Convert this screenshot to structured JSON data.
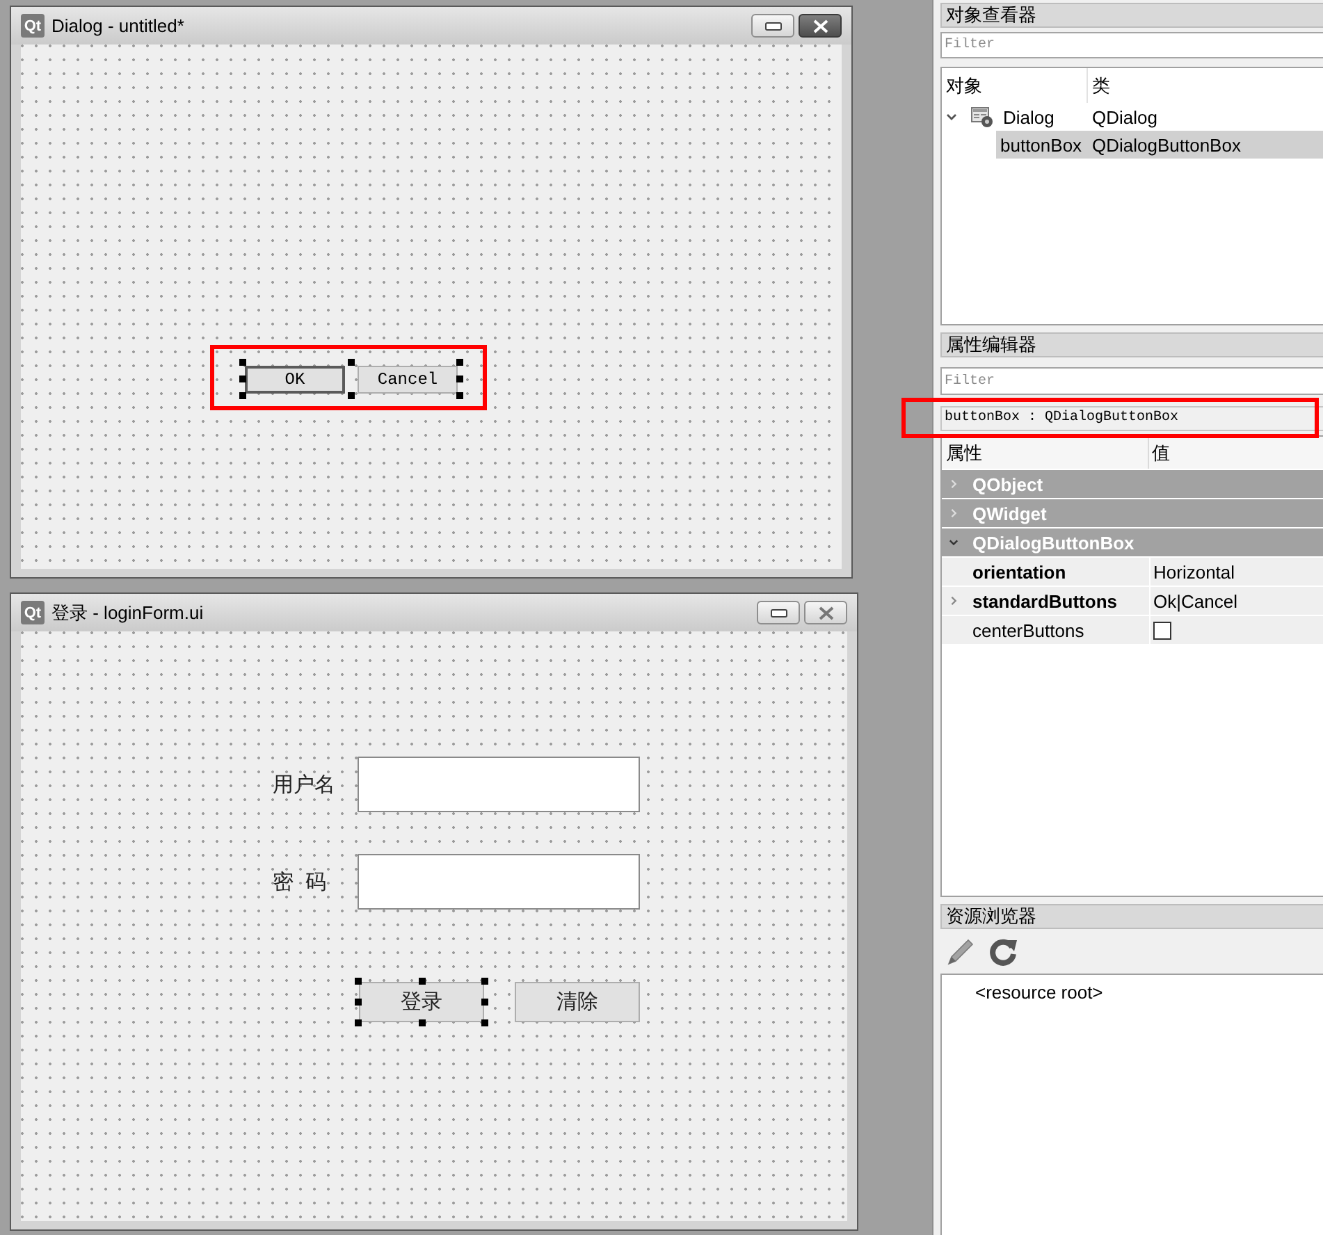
{
  "mdi_windows": [
    {
      "logo": "Qt",
      "title": "Dialog - untitled*",
      "active": true,
      "button_box": {
        "selected": true,
        "buttons": [
          {
            "label": "OK",
            "default": true
          },
          {
            "label": "Cancel",
            "default": false
          }
        ]
      }
    },
    {
      "logo": "Qt",
      "title": "登录 - loginForm.ui",
      "active": false,
      "fields": [
        {
          "label": "用户名"
        },
        {
          "label": "密  码"
        }
      ],
      "buttons": [
        {
          "label": "登录",
          "selected": true
        },
        {
          "label": "清除",
          "selected": false
        }
      ]
    }
  ],
  "object_inspector": {
    "title": "对象查看器",
    "filter": {
      "placeholder": "Filter"
    },
    "columns": [
      "对象",
      "类"
    ],
    "tree": [
      {
        "name": "Dialog",
        "class": "QDialog",
        "expanded": true,
        "selected": false,
        "children": [
          {
            "name": "buttonBox",
            "class": "QDialogButtonBox",
            "selected": true
          }
        ]
      }
    ]
  },
  "property_editor": {
    "title": "属性编辑器",
    "filter": {
      "placeholder": "Filter"
    },
    "object_label": "buttonBox : QDialogButtonBox",
    "columns": [
      "属性",
      "值"
    ],
    "groups": [
      {
        "name": "QObject",
        "expanded": false
      },
      {
        "name": "QWidget",
        "expanded": false
      },
      {
        "name": "QDialogButtonBox",
        "expanded": true,
        "properties": [
          {
            "kind": "text",
            "name": "orientation",
            "value": "Horizontal",
            "modified": true,
            "expandable": false
          },
          {
            "kind": "text",
            "name": "standardButtons",
            "value": "Ok|Cancel",
            "modified": true,
            "expandable": true
          },
          {
            "kind": "checkbox",
            "name": "centerButtons",
            "checked": false,
            "modified": false,
            "expandable": false
          }
        ]
      }
    ]
  },
  "resource_browser": {
    "title": "资源浏览器",
    "root": "<resource root>"
  }
}
